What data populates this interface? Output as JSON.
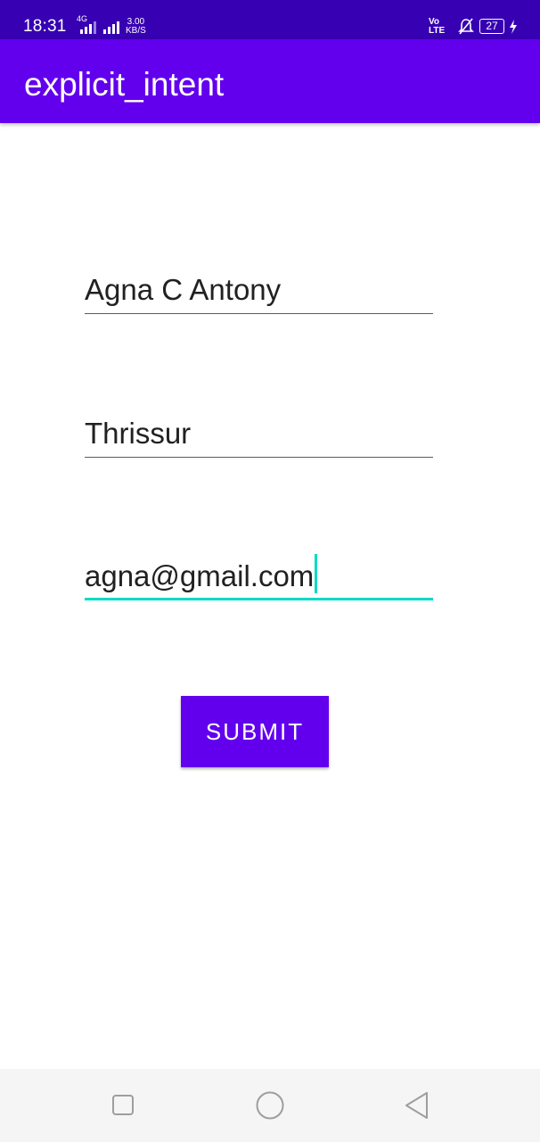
{
  "status_bar": {
    "time": "18:31",
    "network": "4G",
    "speed_value": "3.00",
    "speed_unit": "KB/S",
    "volte_top": "Vo",
    "volte_bottom": "LTE",
    "battery": "27"
  },
  "app_bar": {
    "title": "explicit_intent"
  },
  "form": {
    "name_value": "Agna C Antony",
    "city_value": "Thrissur",
    "email_value": "agna@gmail.com",
    "submit_label": "SUBMIT"
  },
  "nav_bar": {
    "icons": [
      "recents-square-icon",
      "home-circle-icon",
      "back-triangle-icon"
    ]
  },
  "colors": {
    "status_bar": "#3700b3",
    "primary": "#6200ee",
    "accent": "#03dac5"
  }
}
